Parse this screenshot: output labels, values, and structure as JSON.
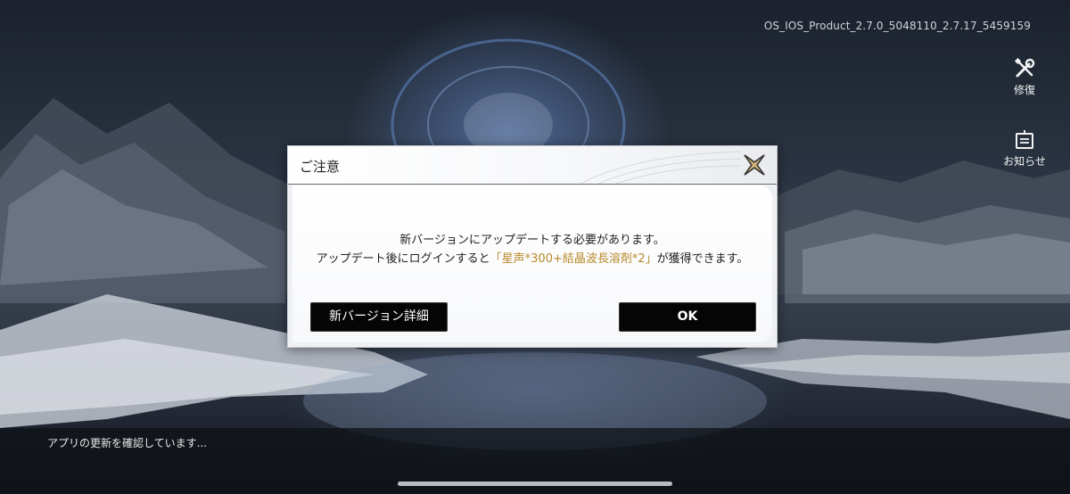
{
  "version_text": "OS_IOS_Product_2.7.0_5048110_2.7.17_5459159",
  "side_menu": {
    "repair_label": "修復",
    "notice_label": "お知らせ"
  },
  "status_text": "アプリの更新を確認しています...",
  "dialog": {
    "title": "ご注意",
    "message_line1": "新バージョンにアップデートする必要があります。",
    "message_line2_prefix": "アップデート後にログインすると",
    "message_line2_highlight": "「星声*300+結晶波長溶剤*2」",
    "message_line2_suffix": "が獲得できます。",
    "details_button": "新バージョン詳細",
    "ok_button": "OK"
  },
  "colors": {
    "highlight": "#b88a2b",
    "button_bg": "#050505",
    "dialog_bg": "#eef0f3"
  },
  "icons": {
    "repair": "wrench-screwdriver-icon",
    "notice": "notice-board-icon",
    "close": "x-cross-icon"
  }
}
